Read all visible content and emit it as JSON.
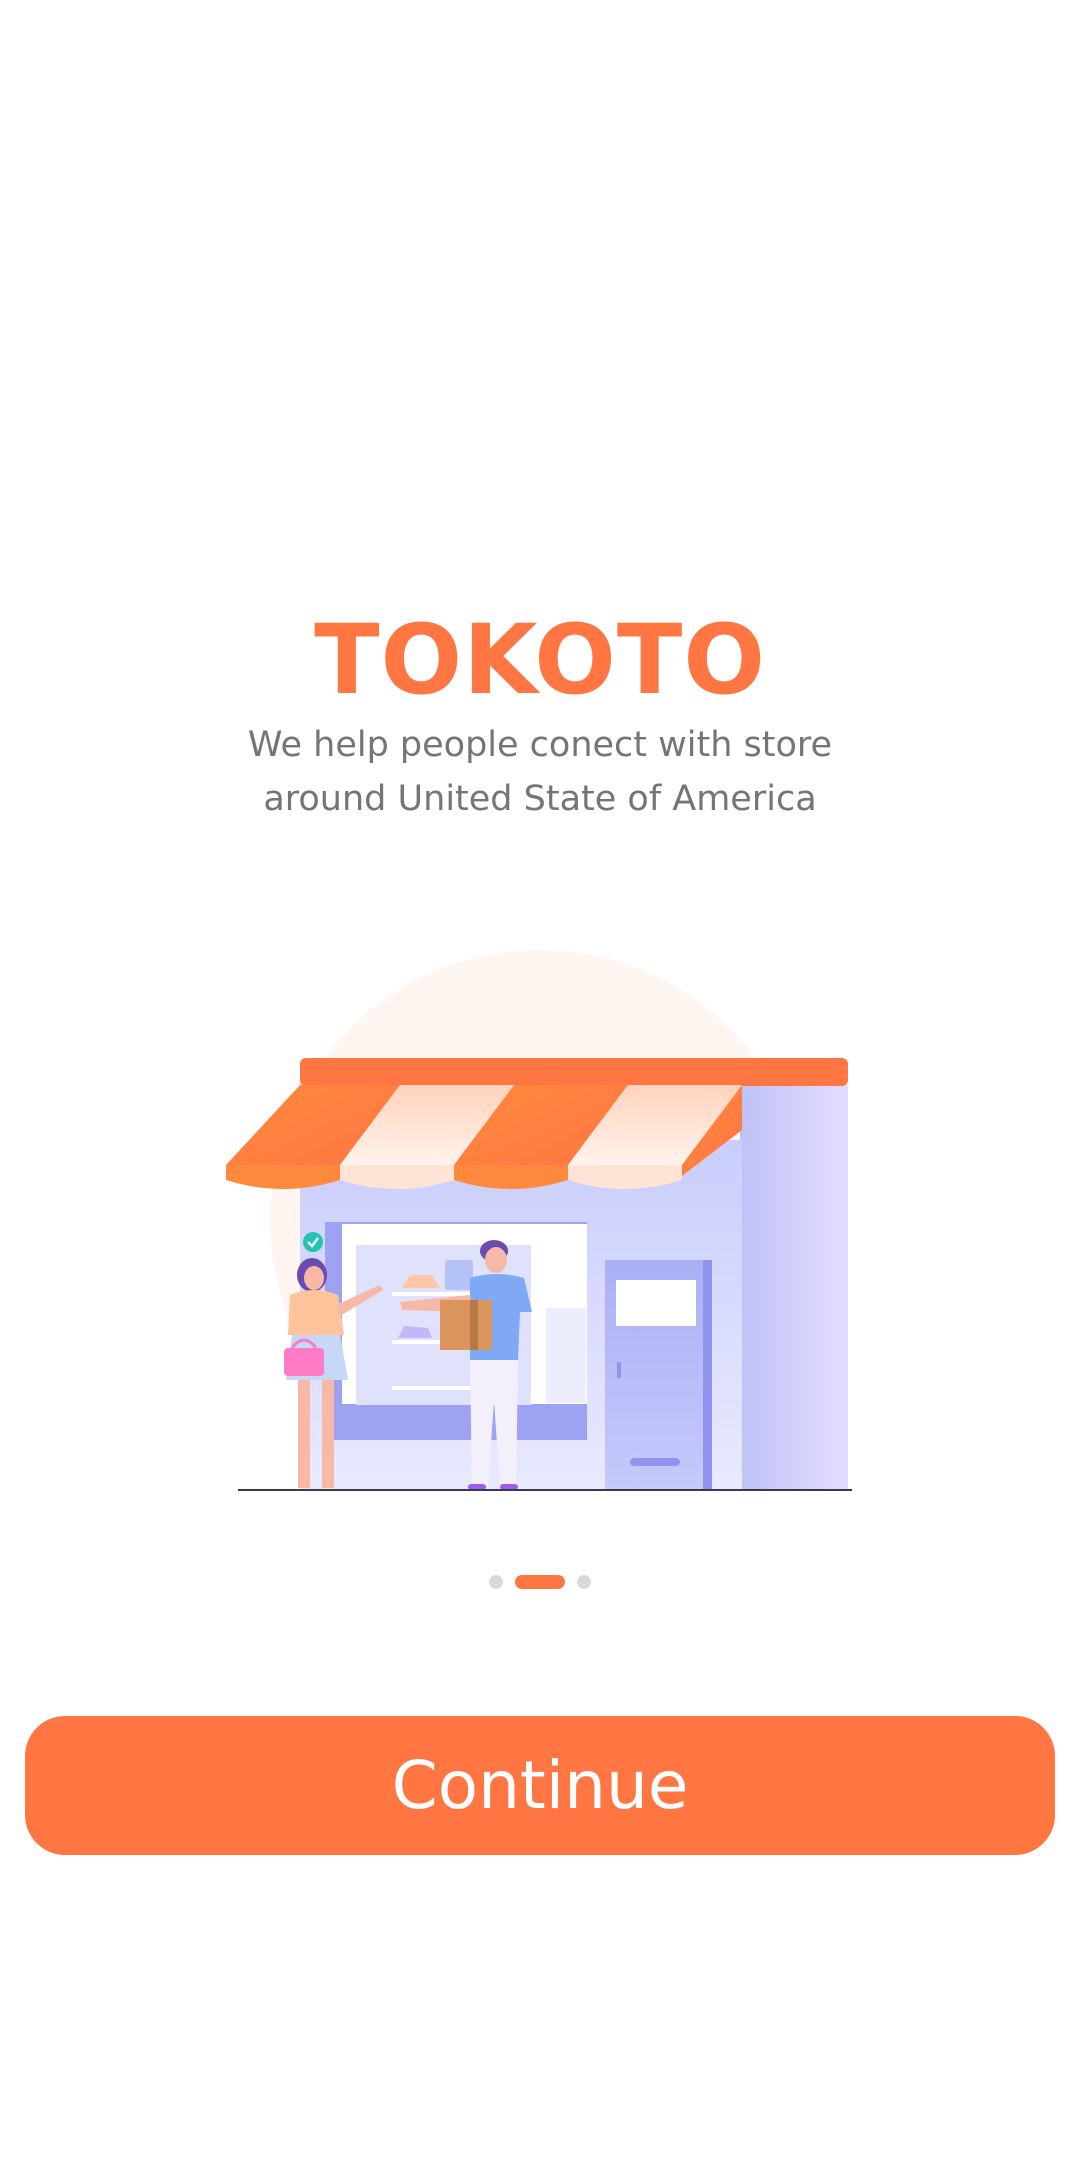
{
  "splash": {
    "title": "TOKOTO",
    "subtitle_lines": [
      "We help people conect with store",
      "around United State of America"
    ]
  },
  "illustration": {
    "icon": "storefront-illustration"
  },
  "pagination": {
    "total": 3,
    "active_index": 1
  },
  "actions": {
    "continue_label": "Continue"
  },
  "colors": {
    "accent": "#FF7643",
    "text_secondary": "#757575",
    "dot_inactive": "#D8D8D8",
    "background": "#FFFFFF"
  }
}
